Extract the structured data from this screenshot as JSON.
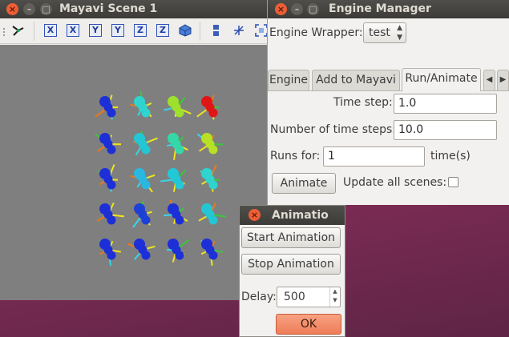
{
  "mayavi_window": {
    "title": "Mayavi Scene 1",
    "toolbar": {
      "axis_buttons": [
        "X",
        "X",
        "Y",
        "Y",
        "Z",
        "Z"
      ],
      "icons": [
        "mayavi-logo-icon",
        "isometric-view-icon",
        "parallel-projection-icon",
        "axes-toggle-icon",
        "fullscreen-icon"
      ]
    }
  },
  "engine_manager": {
    "title": "Engine Manager",
    "engine_wrapper_label": "Engine Wrapper:",
    "engine_wrapper_value": "test",
    "tabs": [
      "Engine",
      "Add to Mayavi",
      "Run/Animate"
    ],
    "active_tab": "Run/Animate",
    "time_step_label": "Time step:",
    "time_step_value": "1.0",
    "num_steps_label": "Number of time steps:",
    "num_steps_value": "10.0",
    "runs_for_label": "Runs for:",
    "runs_for_value": "1",
    "runs_for_unit": "time(s)",
    "animate_button": "Animate",
    "update_all_label": "Update all scenes:",
    "update_all_checked": false
  },
  "animation_dialog": {
    "title": "Animatio",
    "start_button": "Start Animation",
    "stop_button": "Stop Animation",
    "delay_label": "Delay:",
    "delay_value": "500",
    "ok_button": "OK"
  },
  "colors": {
    "close_button": "#ee5e36",
    "titlebar": "#3c3b37",
    "viewport_bg": "#7f7f7f",
    "ok_button": "#ef7d58",
    "desktop": "#8b2f5c"
  }
}
